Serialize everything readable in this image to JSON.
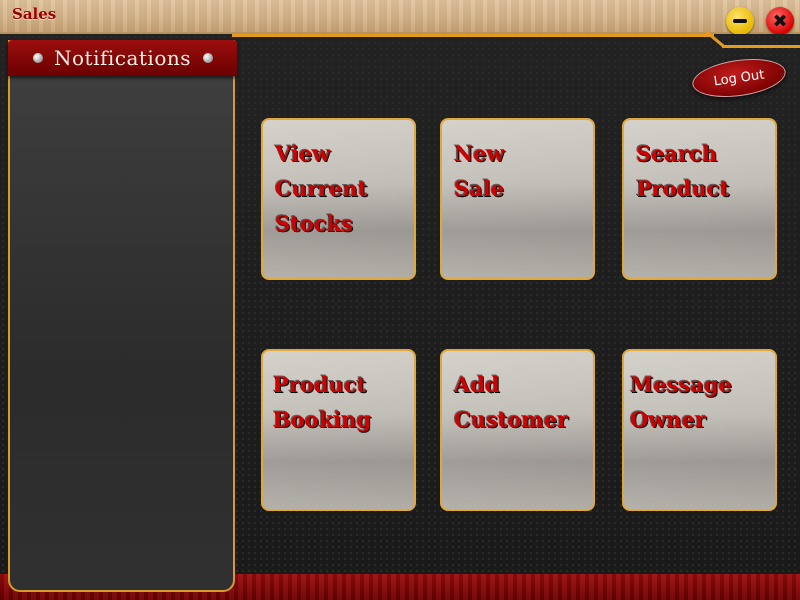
{
  "window": {
    "title": "Sales",
    "minimize_icon": "minimize-icon",
    "close_icon": "close-icon",
    "close_glyph": "✖"
  },
  "notifications": {
    "title": "Notifications"
  },
  "logout": {
    "label": "Log Out"
  },
  "tiles": [
    {
      "label": "View\nCurrent\nStocks"
    },
    {
      "label": "New\nSale"
    },
    {
      "label": "Search\nProduct"
    },
    {
      "label": "Product\nBooking"
    },
    {
      "label": "Add\nCustomer"
    },
    {
      "label": "Message\nOwner"
    }
  ],
  "colors": {
    "accent": "#e39a1e",
    "brand_red": "#9b0e0e",
    "tile_text": "#d00000"
  }
}
